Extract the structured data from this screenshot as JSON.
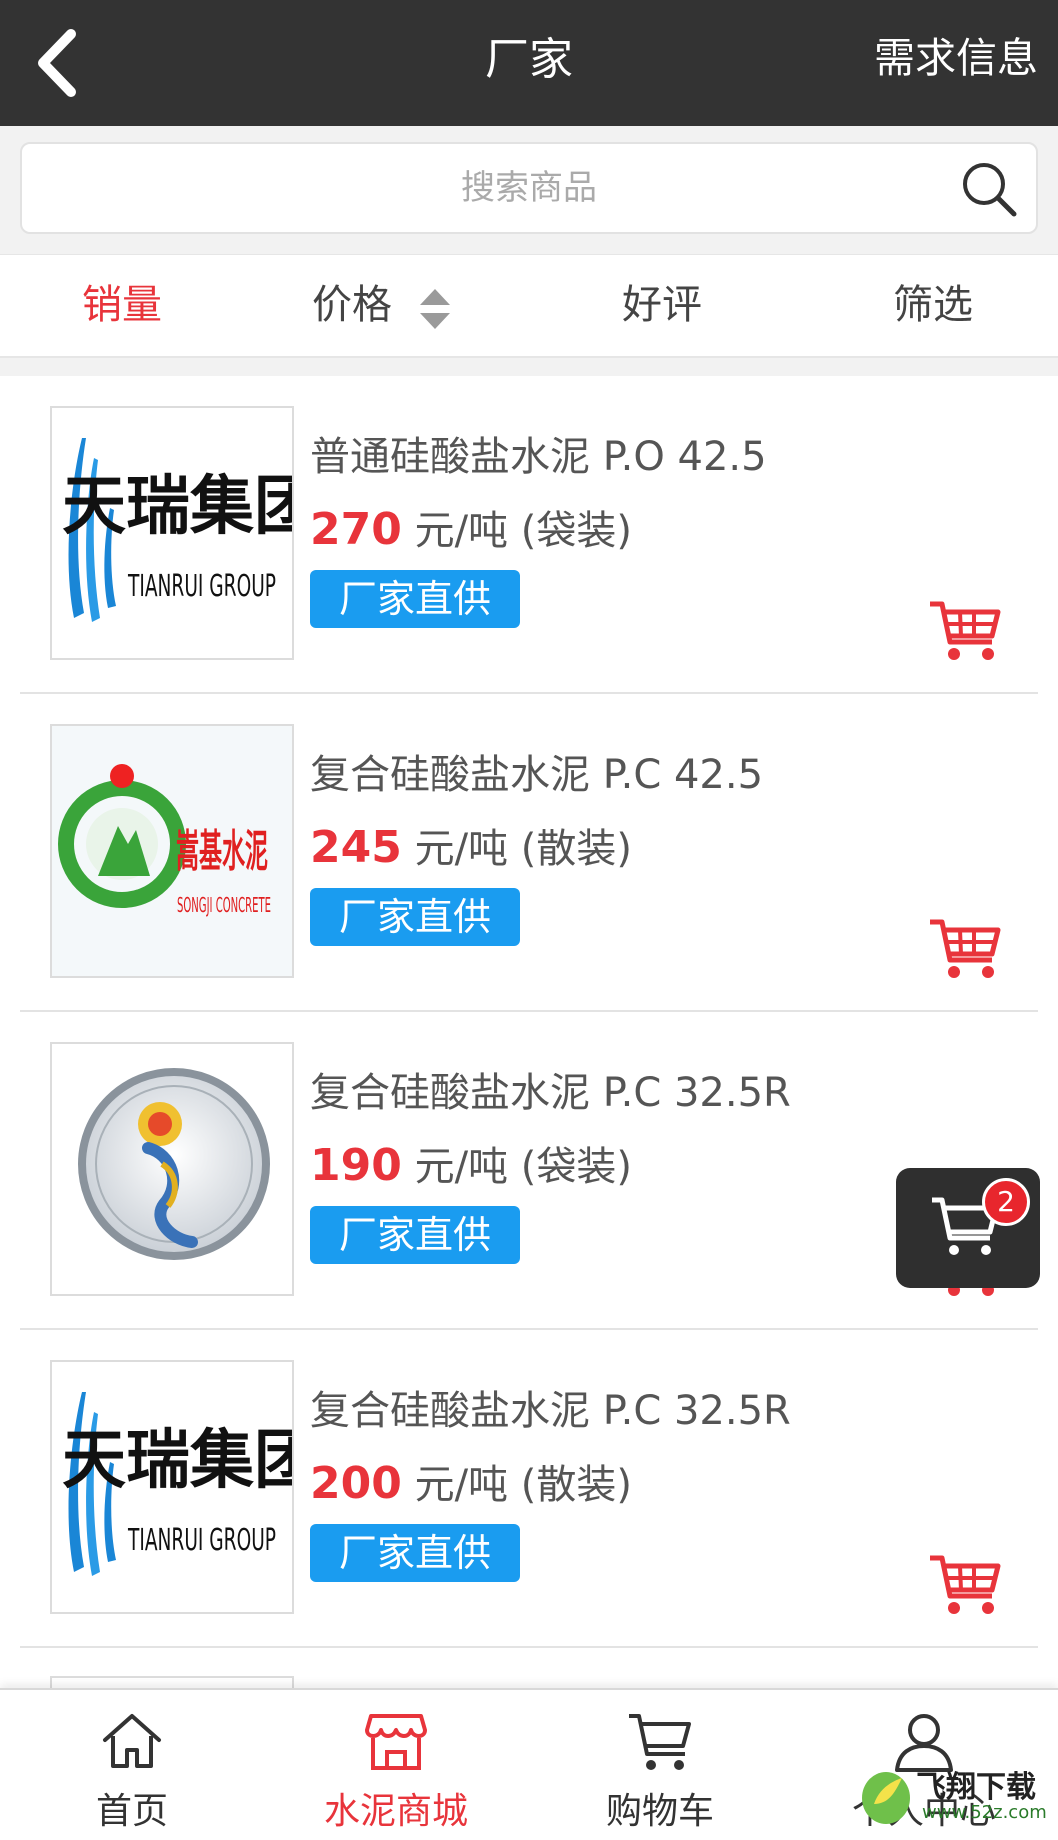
{
  "header": {
    "title": "厂家",
    "right_label": "需求信息"
  },
  "search": {
    "placeholder": "搜索商品"
  },
  "sort": {
    "items": [
      {
        "label": "销量",
        "active": true
      },
      {
        "label": "价格",
        "active": false
      },
      {
        "label": "好评",
        "active": false
      },
      {
        "label": "筛选",
        "active": false
      }
    ]
  },
  "products": [
    {
      "name": "普通硅酸盐水泥 P.O 42.5",
      "price": "270",
      "unit": "元/吨 (袋装)",
      "tag": "厂家直供",
      "logo": "tianrui",
      "logo_text": "天瑞集团",
      "logo_sub": "TIANRUI GROUP"
    },
    {
      "name": "复合硅酸盐水泥 P.C 42.5",
      "price": "245",
      "unit": "元/吨 (散装)",
      "tag": "厂家直供",
      "logo": "songji",
      "logo_text": "嵩基水泥",
      "logo_sub": "SONGJI CONCRETE"
    },
    {
      "name": "复合硅酸盐水泥 P.C 32.5R",
      "price": "190",
      "unit": "元/吨 (袋装)",
      "tag": "厂家直供",
      "logo": "emblem"
    },
    {
      "name": "复合硅酸盐水泥 P.C 32.5R",
      "price": "200",
      "unit": "元/吨 (散装)",
      "tag": "厂家直供",
      "logo": "tianrui",
      "logo_text": "天瑞集团",
      "logo_sub": "TIANRUI GROUP"
    }
  ],
  "floating_cart": {
    "count": "2"
  },
  "bottom_nav": [
    {
      "label": "首页",
      "icon": "home-icon",
      "active": false
    },
    {
      "label": "水泥商城",
      "icon": "store-icon",
      "active": true
    },
    {
      "label": "购物车",
      "icon": "cart-icon",
      "active": false
    },
    {
      "label": "个人中心",
      "icon": "user-icon",
      "active": false
    }
  ],
  "watermark": {
    "text": "飞翔下载",
    "sub": "www.52z.com"
  },
  "colors": {
    "accent": "#e8343b",
    "tag_blue": "#1a9cf0",
    "header_bg": "#333333"
  }
}
